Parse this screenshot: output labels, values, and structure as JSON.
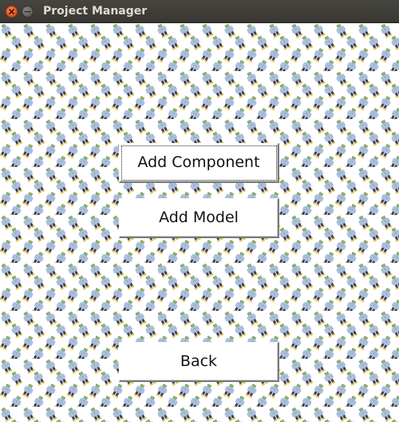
{
  "window": {
    "title": "Project Manager",
    "controls": [
      "close-icon",
      "minimize-icon"
    ]
  },
  "buttons": {
    "add_component": "Add Component",
    "add_model": "Add Model",
    "back": "Back"
  },
  "colors": {
    "titlebar": "#3c3b37",
    "title_text": "#dfdbd2",
    "close_button": "#e95420",
    "button_face": "#ffffff",
    "pattern_figure_body": "#a8bfdc",
    "pattern_figure_head": "#8fae78",
    "pattern_figure_legs": "#3a3f5a",
    "pattern_figure_feet": "#e6c44a"
  }
}
